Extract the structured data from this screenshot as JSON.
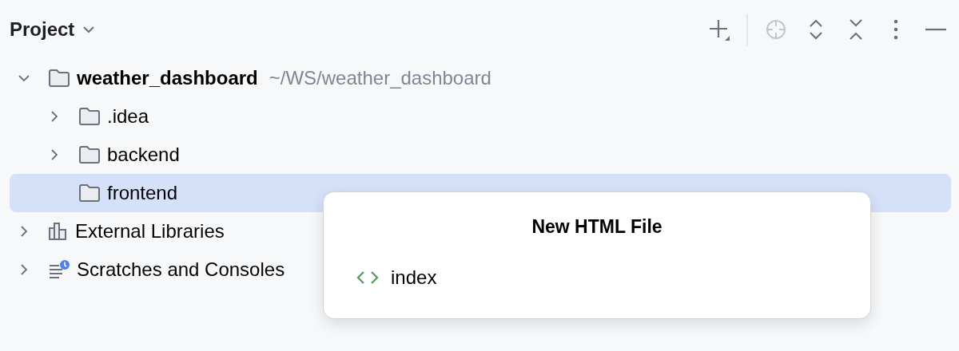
{
  "panel": {
    "title": "Project",
    "toolbar": [
      {
        "kind": "add",
        "disabled": false
      },
      {
        "kind": "locate",
        "disabled": true
      },
      {
        "kind": "expand",
        "disabled": false
      },
      {
        "kind": "collapse",
        "disabled": false
      },
      {
        "kind": "more",
        "disabled": false
      },
      {
        "kind": "hide",
        "disabled": false
      }
    ]
  },
  "tree": [
    {
      "label": "weather_dashboard",
      "path": "~/WS/weather_dashboard",
      "kind": "folder",
      "expandable": true,
      "expanded": true,
      "selected": false,
      "children": [
        {
          "label": ".idea",
          "kind": "folder",
          "expandable": true,
          "expanded": false,
          "selected": false
        },
        {
          "label": "backend",
          "kind": "folder",
          "expandable": true,
          "expanded": false,
          "selected": false
        },
        {
          "label": "frontend",
          "kind": "folder",
          "expandable": false,
          "expanded": false,
          "selected": true
        }
      ]
    },
    {
      "label": "External Libraries",
      "kind": "library",
      "expandable": true,
      "expanded": false,
      "selected": false
    },
    {
      "label": "Scratches and Consoles",
      "kind": "scratches",
      "expandable": true,
      "expanded": false,
      "selected": false
    }
  ],
  "popup": {
    "title": "New HTML File",
    "items": [
      {
        "label": "index",
        "kind": "html"
      }
    ]
  }
}
